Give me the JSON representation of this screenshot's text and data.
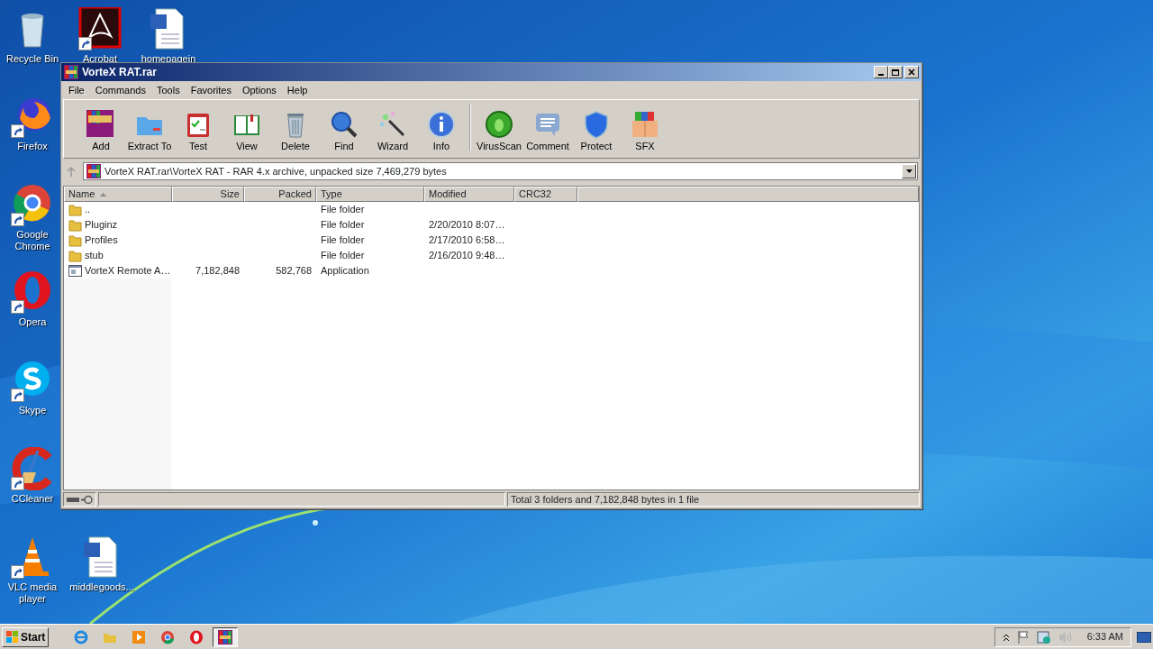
{
  "desktop_icons": [
    {
      "label": "Recycle Bin",
      "shortcut": false
    },
    {
      "label": "Acrobat",
      "shortcut": true
    },
    {
      "label": "homepagein",
      "shortcut": false
    },
    {
      "label": "Firefox",
      "shortcut": true
    },
    {
      "label": "Google Chrome",
      "shortcut": true
    },
    {
      "label": "Opera",
      "shortcut": true
    },
    {
      "label": "Skype",
      "shortcut": true
    },
    {
      "label": "CCleaner",
      "shortcut": true
    },
    {
      "label": "VLC media player",
      "shortcut": true
    },
    {
      "label": "middlegoods...",
      "shortcut": false
    }
  ],
  "window": {
    "title": "VorteX RAT.rar",
    "menu": [
      "File",
      "Commands",
      "Tools",
      "Favorites",
      "Options",
      "Help"
    ],
    "toolbar": [
      {
        "label": "Add"
      },
      {
        "label": "Extract To"
      },
      {
        "label": "Test"
      },
      {
        "label": "View"
      },
      {
        "label": "Delete"
      },
      {
        "label": "Find"
      },
      {
        "label": "Wizard"
      },
      {
        "label": "Info"
      },
      {
        "label": "VirusScan"
      },
      {
        "label": "Comment"
      },
      {
        "label": "Protect"
      },
      {
        "label": "SFX"
      }
    ],
    "path": "VorteX RAT.rar\\VorteX RAT - RAR 4.x archive, unpacked size 7,469,279 bytes",
    "columns": [
      {
        "label": "Name",
        "sorted": true
      },
      {
        "label": "Size",
        "sorted": false
      },
      {
        "label": "Packed",
        "sorted": false
      },
      {
        "label": "Type",
        "sorted": false
      },
      {
        "label": "Modified",
        "sorted": false
      },
      {
        "label": "CRC32",
        "sorted": false
      }
    ],
    "rows": [
      {
        "kind": "folder",
        "cells": [
          "..",
          "",
          "",
          "File folder",
          "",
          ""
        ]
      },
      {
        "kind": "folder",
        "cells": [
          "Pluginz",
          "",
          "",
          "File folder",
          "2/20/2010 8:07…",
          ""
        ]
      },
      {
        "kind": "folder",
        "cells": [
          "Profiles",
          "",
          "",
          "File folder",
          "2/17/2010 6:58…",
          ""
        ]
      },
      {
        "kind": "folder",
        "cells": [
          "stub",
          "",
          "",
          "File folder",
          "2/16/2010 9:48…",
          ""
        ]
      },
      {
        "kind": "application",
        "cells": [
          "VorteX Remote A…",
          "7,182,848",
          "582,768",
          "Application",
          "",
          ""
        ]
      }
    ],
    "status": "Total 3 folders and 7,182,848 bytes in 1 file"
  },
  "taskbar": {
    "start": "Start",
    "apps": [
      {
        "selected": false
      },
      {
        "selected": false
      },
      {
        "selected": false
      },
      {
        "selected": false
      },
      {
        "selected": false
      },
      {
        "selected": true
      }
    ],
    "clock": "6:33 AM"
  }
}
